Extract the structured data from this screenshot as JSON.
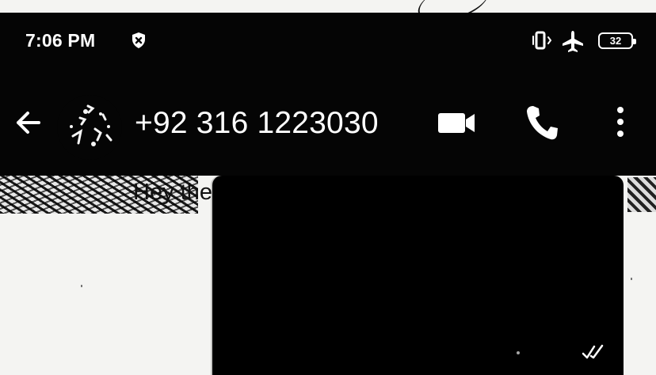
{
  "status_bar": {
    "time": "7:06 PM",
    "battery_level": "32",
    "icons": [
      "shield-icon",
      "vibrate-icon",
      "airplane-icon",
      "battery-icon"
    ]
  },
  "app_bar": {
    "contact_name": "+92 316 1223030",
    "actions": [
      "video-call-icon",
      "phone-call-icon",
      "more-options-icon"
    ]
  },
  "profile": {
    "about": "Hey there! I am using WhatsApp."
  },
  "colors": {
    "header_background": "#050505",
    "panel_background": "#000000",
    "text_light": "#ffffff",
    "text_dark": "#111111",
    "page_background": "#f4f4f2"
  }
}
